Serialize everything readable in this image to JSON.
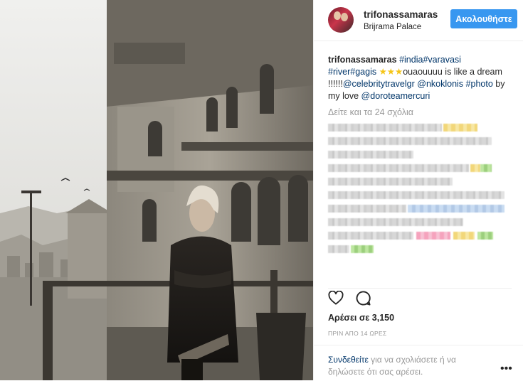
{
  "header": {
    "username": "trifonassamaras",
    "location": "Brijrama Palace",
    "follow_label": "Ακολουθήστε"
  },
  "caption": {
    "username": "trifonassamaras",
    "tag_india": "#india",
    "tag_varavasi": "#varavasi",
    "tag_river": "#river",
    "tag_gagis": "#gagis",
    "stars": "★★★",
    "text1": "ouaouuuu is like a dream !!!!!!",
    "mention1": "@celebritytravelgr",
    "mention2": "@nkoklonis",
    "tag_photo": "#photo",
    "text2": " by my love ",
    "mention3": "@doroteamercuri"
  },
  "view_all_comments": "Δείτε και τα 24 σχόλια",
  "likes": "Αρέσει σε 3,150",
  "timestamp": "ΠΡΙΝ ΑΠΟ 14 ΩΡΕΣ",
  "login_prompt": {
    "link": "Συνδεθείτε",
    "text": " για να σχολιάσετε ή να δηλώσετε ότι σας αρέσει."
  },
  "more_options": "•••",
  "icons": {
    "like": "heart-icon",
    "comment": "comment-bubble-icon",
    "more": "more-options-icon"
  },
  "colors": {
    "follow_button": "#3897f0",
    "link": "#003569",
    "muted": "#999999"
  }
}
